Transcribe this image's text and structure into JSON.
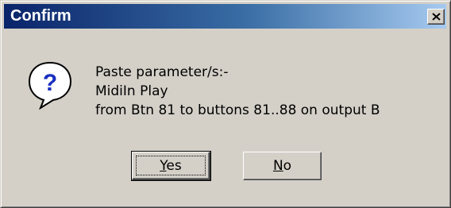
{
  "window": {
    "title": "Confirm"
  },
  "title_bar": {
    "close_label": "×"
  },
  "icon": {
    "name": "question-icon",
    "glyph": "?",
    "color": "#1a2fbf"
  },
  "message": {
    "lines": [
      "Paste parameter/s:-",
      "MidiIn Play",
      "from Btn 81 to buttons 81..88 on output B"
    ]
  },
  "buttons": {
    "yes": {
      "mnemonic": "Y",
      "rest": "es"
    },
    "no": {
      "mnemonic": "N",
      "rest": "o"
    }
  }
}
